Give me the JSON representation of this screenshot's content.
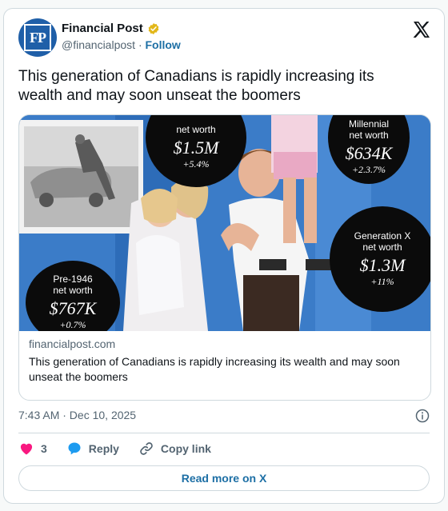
{
  "account": {
    "avatar_text": "FP",
    "name": "Financial Post",
    "handle": "@financialpost",
    "separator": "·",
    "follow_label": "Follow"
  },
  "tweet": {
    "text": "This generation of Canadians is rapidly increasing its wealth and may soon unseat the boomers"
  },
  "link_card": {
    "bubbles": [
      {
        "label": "Pre-1946\nnet worth",
        "value": "$767K",
        "change": "+0.7%"
      },
      {
        "label": "net worth",
        "value": "$1.5M",
        "change": "+5.4%"
      },
      {
        "label": "Millennial\nnet worth",
        "value": "$634K",
        "change": "+2.3.7%"
      },
      {
        "label": "Generation X\nnet worth",
        "value": "$1.3M",
        "change": "+11%"
      }
    ],
    "domain": "financialpost.com",
    "title": "This generation of Canadians is rapidly increasing its wealth and may soon unseat the boomers"
  },
  "meta": {
    "timestamp": "7:43 AM · Dec 10, 2025"
  },
  "actions": {
    "like_count": "3",
    "reply_label": "Reply",
    "copy_link_label": "Copy link"
  },
  "read_more_label": "Read more on X",
  "colors": {
    "brand_blue": "#1d6fa5",
    "like_red": "#f91880",
    "reply_blue": "#1d9bf0",
    "verified_gold": "#e2b719",
    "avatar_blue": "#1f5fa8"
  },
  "icons": [
    "verified-icon",
    "x-logo-icon",
    "info-icon",
    "heart-icon",
    "reply-icon",
    "link-icon"
  ]
}
